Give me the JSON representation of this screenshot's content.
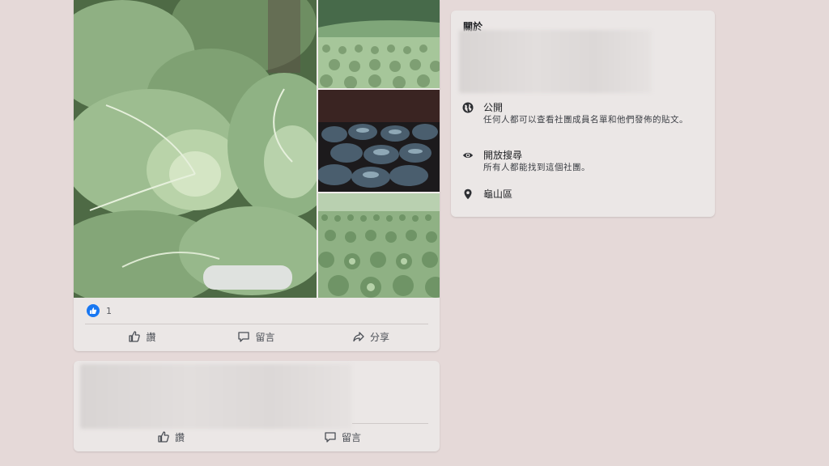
{
  "post": {
    "photos": [
      {
        "name": "cabbage-closeup"
      },
      {
        "name": "cabbage-field-hillside"
      },
      {
        "name": "cabbage-night-harvest"
      },
      {
        "name": "cabbage-field-wide"
      }
    ],
    "reaction_count": "1",
    "actions": {
      "like": "讚",
      "comment": "留言",
      "share": "分享"
    }
  },
  "second_post": {
    "actions": {
      "like": "讚",
      "comment": "留言"
    }
  },
  "about": {
    "title": "關於",
    "privacy": {
      "label": "公開",
      "description": "任何人都可以查看社團成員名單和他們發佈的貼文。"
    },
    "visibility": {
      "label": "開放搜尋",
      "description": "所有人都能找到這個社團。"
    },
    "location": {
      "label": "龜山區"
    }
  },
  "colors": {
    "page_background": "#e5d9d8",
    "card_background": "#ebe7e6",
    "like_blue": "#1877f2"
  },
  "icons": {
    "like_badge": "thumbs-up-badge-icon",
    "like_action": "thumbs-up-icon",
    "comment_action": "speech-bubble-icon",
    "share_action": "share-arrow-icon",
    "privacy": "globe-icon",
    "visibility": "eye-icon",
    "location": "map-pin-icon"
  }
}
